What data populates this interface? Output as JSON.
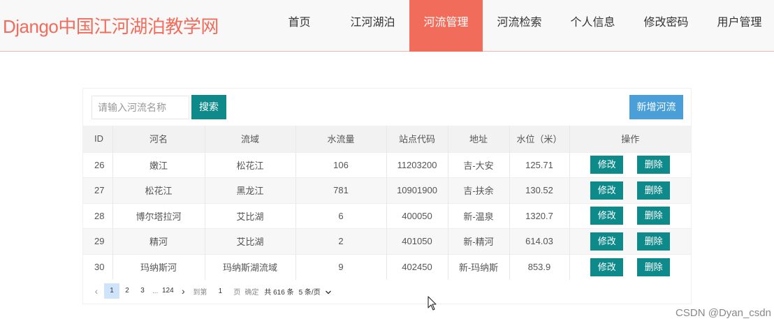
{
  "header": {
    "brand": "Django中国江河湖泊教学网",
    "nav": [
      "首页",
      "江河湖泊",
      "河流管理",
      "河流检索",
      "个人信息",
      "修改密码",
      "用户管理"
    ],
    "active_index": 2,
    "accent_color": "#f26c5b"
  },
  "toolbar": {
    "search_placeholder": "请输入河流名称",
    "search_label": "搜索",
    "add_label": "新增河流"
  },
  "table": {
    "columns": [
      "ID",
      "河名",
      "流域",
      "水流量",
      "站点代码",
      "地址",
      "水位（米）",
      "操作"
    ],
    "rows": [
      [
        "26",
        "嫩江",
        "松花江",
        "106",
        "11203200",
        "吉-大安",
        "125.71"
      ],
      [
        "27",
        "松花江",
        "黑龙江",
        "781",
        "10901900",
        "吉-扶余",
        "130.52"
      ],
      [
        "28",
        "博尔塔拉河",
        "艾比湖",
        "6",
        "400050",
        "新-温泉",
        "1320.7"
      ],
      [
        "29",
        "精河",
        "艾比湖",
        "2",
        "401050",
        "新-精河",
        "614.03"
      ],
      [
        "30",
        "玛纳斯河",
        "玛纳斯湖流域",
        "9",
        "402450",
        "新-玛纳斯",
        "853.9"
      ]
    ],
    "edit_label": "修改",
    "delete_label": "删除",
    "button_color": "#0f8a8a"
  },
  "pager": {
    "prev": "‹",
    "pages": [
      "1",
      "2",
      "3"
    ],
    "ellipsis": "...",
    "last_page": "124",
    "next": "›",
    "goto_label": "到第",
    "goto_value": "1",
    "page_unit": "页",
    "confirm_label": "确定",
    "total": "共 616 条",
    "page_size": "5 条/页",
    "current_page": "1"
  },
  "watermark": "CSDN @Dyan_csdn"
}
